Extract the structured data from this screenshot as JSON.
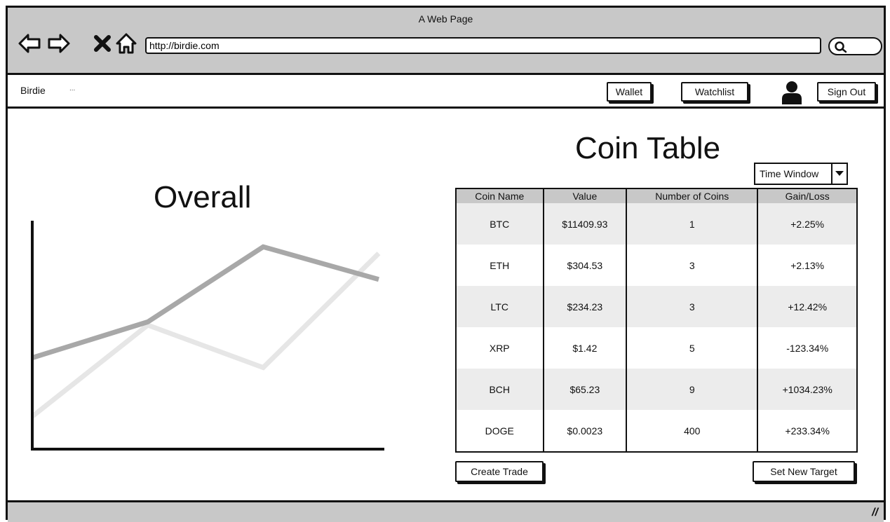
{
  "browser": {
    "title": "A Web Page",
    "url": "http://birdie.com"
  },
  "nav": {
    "brand": "Birdie",
    "brand_more": "...",
    "wallet_label": "Wallet",
    "watchlist_label": "Watchlist",
    "signout_label": "Sign Out"
  },
  "chart": {
    "heading": "Overall"
  },
  "chart_data": {
    "type": "line",
    "x": [
      0,
      1,
      2,
      3
    ],
    "series": [
      {
        "values": [
          1.0,
          3.8,
          2.5,
          6.0
        ],
        "color": "#e6e6e6"
      },
      {
        "values": [
          2.8,
          3.9,
          6.2,
          5.2
        ],
        "color": "#a8a8a8"
      }
    ],
    "ylim": [
      0,
      7
    ],
    "title": "Overall",
    "xlabel": "",
    "ylabel": ""
  },
  "table": {
    "heading": "Coin Table",
    "time_window_label": "Time Window",
    "columns": [
      "Coin Name",
      "Value",
      "Number of Coins",
      "Gain/Loss"
    ],
    "rows": [
      [
        "BTC",
        "$11409.93",
        "1",
        "+2.25%"
      ],
      [
        "ETH",
        "$304.53",
        "3",
        "+2.13%"
      ],
      [
        "LTC",
        "$234.23",
        "3",
        "+12.42%"
      ],
      [
        "XRP",
        "$1.42",
        "5",
        "-123.34%"
      ],
      [
        "BCH",
        "$65.23",
        "9",
        "+1034.23%"
      ],
      [
        "DOGE",
        "$0.0023",
        "400",
        "+233.34%"
      ]
    ],
    "create_trade_label": "Create Trade",
    "set_target_label": "Set New Target"
  },
  "status": {
    "grip": "//"
  }
}
